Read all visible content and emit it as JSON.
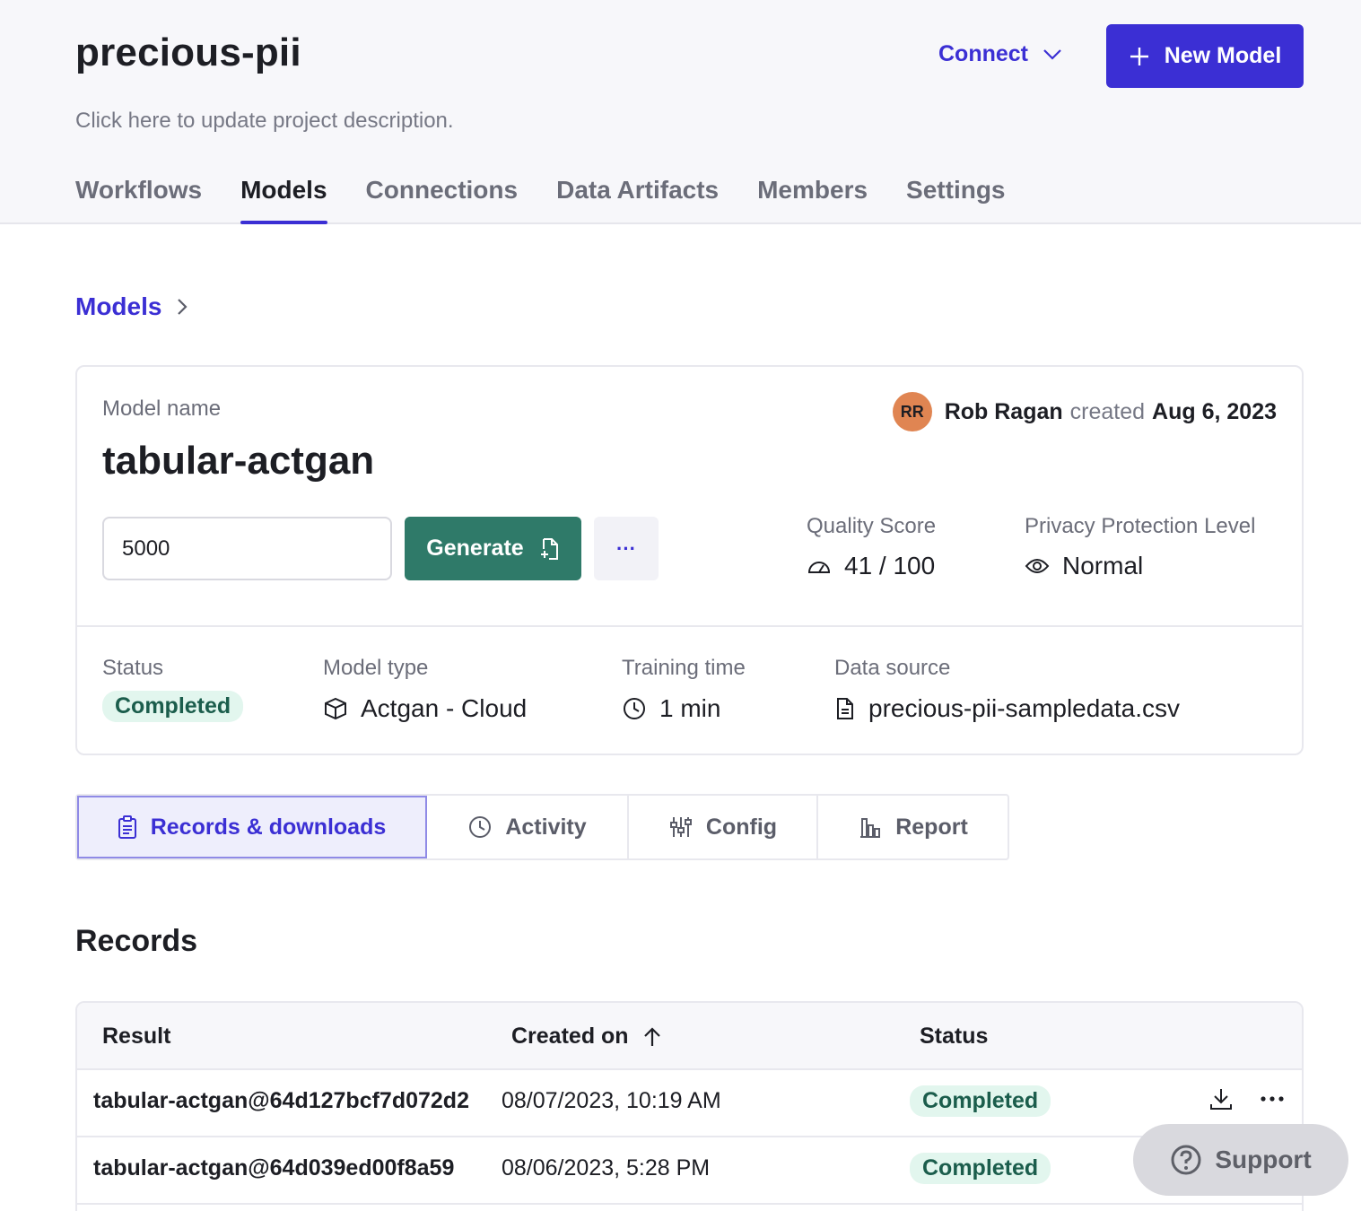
{
  "project": {
    "title": "precious-pii",
    "description": "Click here to update project description."
  },
  "header": {
    "connect_label": "Connect",
    "new_model_label": "New Model"
  },
  "nav": {
    "tabs": [
      {
        "label": "Workflows",
        "active": false
      },
      {
        "label": "Models",
        "active": true
      },
      {
        "label": "Connections",
        "active": false
      },
      {
        "label": "Data Artifacts",
        "active": false
      },
      {
        "label": "Members",
        "active": false
      },
      {
        "label": "Settings",
        "active": false
      }
    ]
  },
  "breadcrumb": {
    "label": "Models"
  },
  "model": {
    "name_label": "Model name",
    "name": "tabular-actgan",
    "creator_initials": "RR",
    "creator_name": "Rob Ragan",
    "created_word": "created",
    "created_date": "Aug 6, 2023",
    "record_count": "5000",
    "generate_label": "Generate",
    "more_label": "···",
    "quality_label": "Quality Score",
    "quality_value": "41 / 100",
    "privacy_label": "Privacy Protection Level",
    "privacy_value": "Normal",
    "status_label": "Status",
    "status_value": "Completed",
    "type_label": "Model type",
    "type_value": "Actgan - Cloud",
    "training_label": "Training time",
    "training_value": "1 min",
    "source_label": "Data source",
    "source_value": "precious-pii-sampledata.csv"
  },
  "detail_tabs": {
    "records": "Records & downloads",
    "activity": "Activity",
    "config": "Config",
    "report": "Report"
  },
  "records": {
    "title": "Records",
    "columns": {
      "result": "Result",
      "created": "Created on",
      "status": "Status"
    },
    "rows": [
      {
        "result": "tabular-actgan@64d127bcf7d072d2",
        "created": "08/07/2023, 10:19 AM",
        "status": "Completed"
      },
      {
        "result": "tabular-actgan@64d039ed00f8a59",
        "created": "08/06/2023, 5:28 PM",
        "status": "Completed"
      }
    ]
  },
  "support": {
    "label": "Support"
  },
  "colors": {
    "accent": "#3b2fd4",
    "generate": "#2f7a69",
    "avatar": "#e08552",
    "badge_bg": "#e2f6ee"
  }
}
